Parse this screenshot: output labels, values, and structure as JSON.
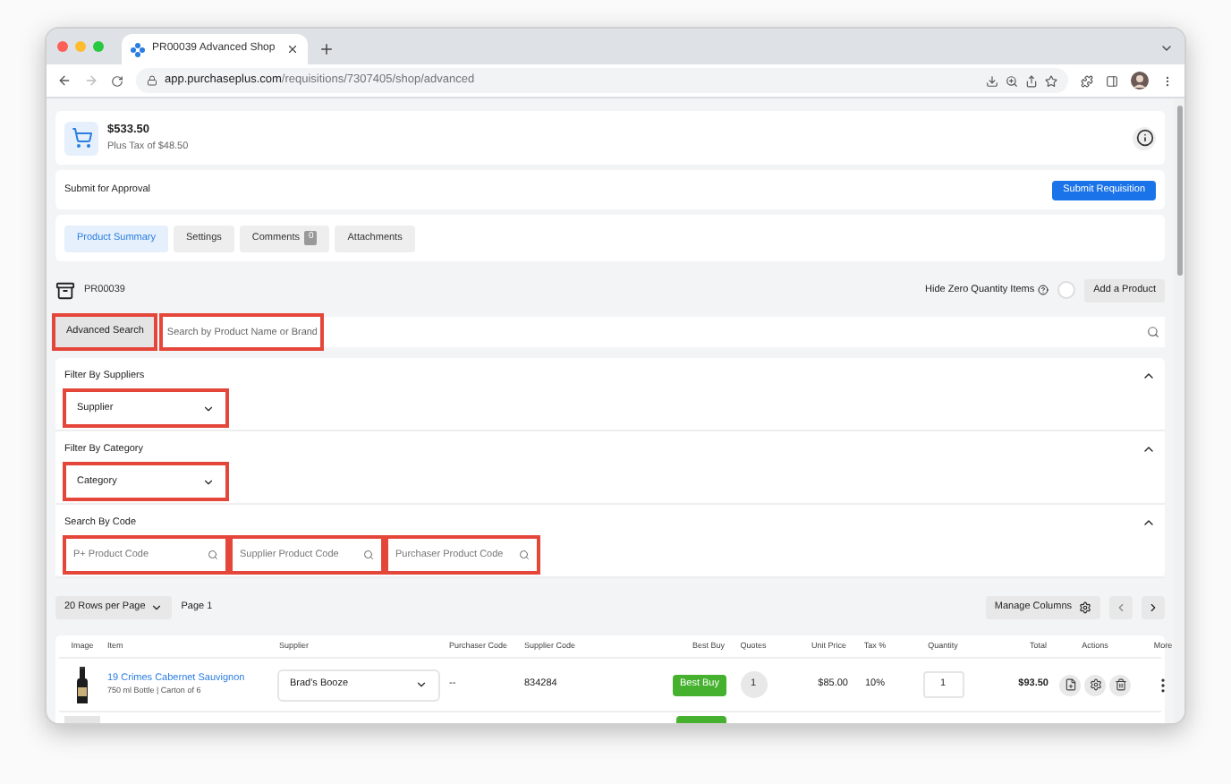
{
  "browser": {
    "tab_title": "PR00039 Advanced Shop",
    "url_host": "app.purchaseplus.com",
    "url_path": "/requisitions/7307405/shop/advanced"
  },
  "summary": {
    "total": "$533.50",
    "tax": "Plus Tax of $48.50"
  },
  "approval": {
    "label": "Submit for Approval",
    "button": "Submit Requisition"
  },
  "tabs": [
    {
      "label": "Product Summary",
      "selected": true
    },
    {
      "label": "Settings",
      "selected": false
    },
    {
      "label": "Comments",
      "badge": "0",
      "selected": false
    },
    {
      "label": "Attachments",
      "selected": false
    }
  ],
  "toolbar": {
    "requisition": "PR00039",
    "hide_zero_label": "Hide Zero Quantity Items",
    "hide_zero_on": false,
    "add_button": "Add a Product"
  },
  "search": {
    "advanced_button": "Advanced Search",
    "advanced_highlighted": true,
    "placeholder": "Search by Product Name or Brand",
    "highlighted": true
  },
  "filters": [
    {
      "title": "Filter By Suppliers",
      "expanded": true,
      "fields": [
        {
          "kind": "select",
          "placeholder": "Supplier",
          "highlighted": true
        }
      ]
    },
    {
      "title": "Filter By Category",
      "expanded": true,
      "fields": [
        {
          "kind": "select",
          "placeholder": "Category",
          "highlighted": true
        }
      ]
    },
    {
      "title": "Search By Code",
      "expanded": true,
      "fields": [
        {
          "kind": "search",
          "placeholder": "P+ Product Code",
          "highlighted": true
        },
        {
          "kind": "search",
          "placeholder": "Supplier Product Code",
          "highlighted": true
        },
        {
          "kind": "search",
          "placeholder": "Purchaser Product Code",
          "highlighted": true
        }
      ]
    }
  ],
  "pagination": {
    "rows_per_page": "20 Rows per Page",
    "page": "Page 1",
    "manage_columns": "Manage Columns"
  },
  "table": {
    "columns": [
      "Image",
      "Item",
      "Supplier",
      "Purchaser Code",
      "Supplier Code",
      "Best Buy",
      "Quotes",
      "Unit Price",
      "Tax %",
      "Quantity",
      "Total",
      "Actions",
      "More"
    ],
    "rows": [
      {
        "name": "19 Crimes Cabernet Sauvignon",
        "detail": "750 ml Bottle | Carton of 6",
        "supplier": "Brad's Booze",
        "purchaser_code": "--",
        "supplier_code": "834284",
        "best_buy": "Best Buy",
        "quotes": "1",
        "unit_price": "$85.00",
        "tax": "10%",
        "quantity": "1",
        "total": "$93.50"
      }
    ]
  }
}
